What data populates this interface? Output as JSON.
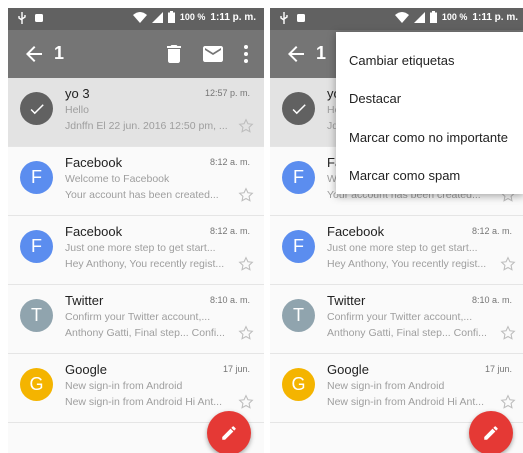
{
  "status_bar": {
    "battery_pct": "100 %",
    "time": "1:11 p. m."
  },
  "action_bar": {
    "selected_count": "1",
    "back_icon": "arrow-left-icon",
    "delete_icon": "trash-icon",
    "mark_read_icon": "envelope-icon",
    "more_icon": "more-vert-icon"
  },
  "emails": [
    {
      "sender": "yo 3",
      "time": "12:57 p. m.",
      "subject": "Hello",
      "snippet": "Jdnffn El 22 jun. 2016 12:50 pm, ...",
      "avatar_letter": "",
      "avatar_color": "#616161",
      "selected": true
    },
    {
      "sender": "Facebook",
      "time": "8:12 a. m.",
      "subject": "Welcome to Facebook",
      "snippet": "Your account has been created...",
      "avatar_letter": "F",
      "avatar_color": "#5b8def",
      "selected": false
    },
    {
      "sender": "Facebook",
      "time": "8:12 a. m.",
      "subject": "Just one more step to get start...",
      "snippet": "Hey Anthony, You recently regist...",
      "avatar_letter": "F",
      "avatar_color": "#5b8def",
      "selected": false
    },
    {
      "sender": "Twitter",
      "time": "8:10 a. m.",
      "subject": "Confirm your Twitter account,...",
      "snippet": "Anthony Gatti, Final step... Confi...",
      "avatar_letter": "T",
      "avatar_color": "#90a4ae",
      "selected": false
    },
    {
      "sender": "Google",
      "time": "17 jun.",
      "subject": "New sign-in from Android",
      "snippet": "New sign-in from Android Hi Ant...",
      "avatar_letter": "G",
      "avatar_color": "#f4b400",
      "selected": false
    }
  ],
  "overflow_menu": {
    "items": [
      "Cambiar etiquetas",
      "Destacar",
      "Marcar como no importante",
      "Marcar como spam"
    ]
  },
  "colors": {
    "action_bar": "#757575",
    "status_bar": "#616161",
    "fab": "#e53935",
    "selected_row": "#e3e3e3"
  },
  "fab_icon": "pencil-icon"
}
